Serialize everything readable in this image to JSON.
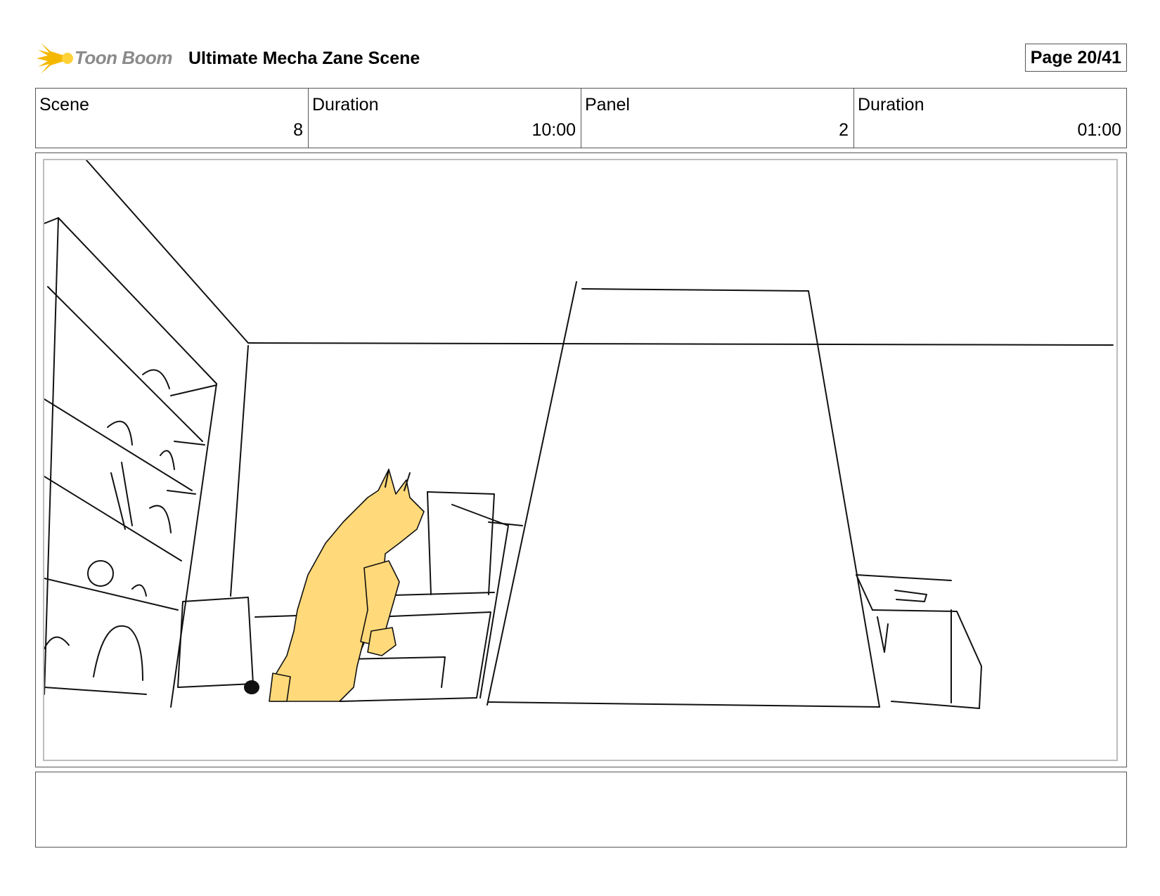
{
  "header": {
    "logo_text": "Toon Boom",
    "project_title": "Ultimate Mecha Zane Scene",
    "page_label": "Page 20/41"
  },
  "info": {
    "scene_label": "Scene",
    "scene_value": "8",
    "scene_duration_label": "Duration",
    "scene_duration_value": "10:00",
    "panel_label": "Panel",
    "panel_value": "2",
    "panel_duration_label": "Duration",
    "panel_duration_value": "01:00"
  },
  "panel": {
    "sketch_fill_color": "#ffd97a",
    "line_color": "#111111"
  },
  "notes": {
    "text": ""
  }
}
